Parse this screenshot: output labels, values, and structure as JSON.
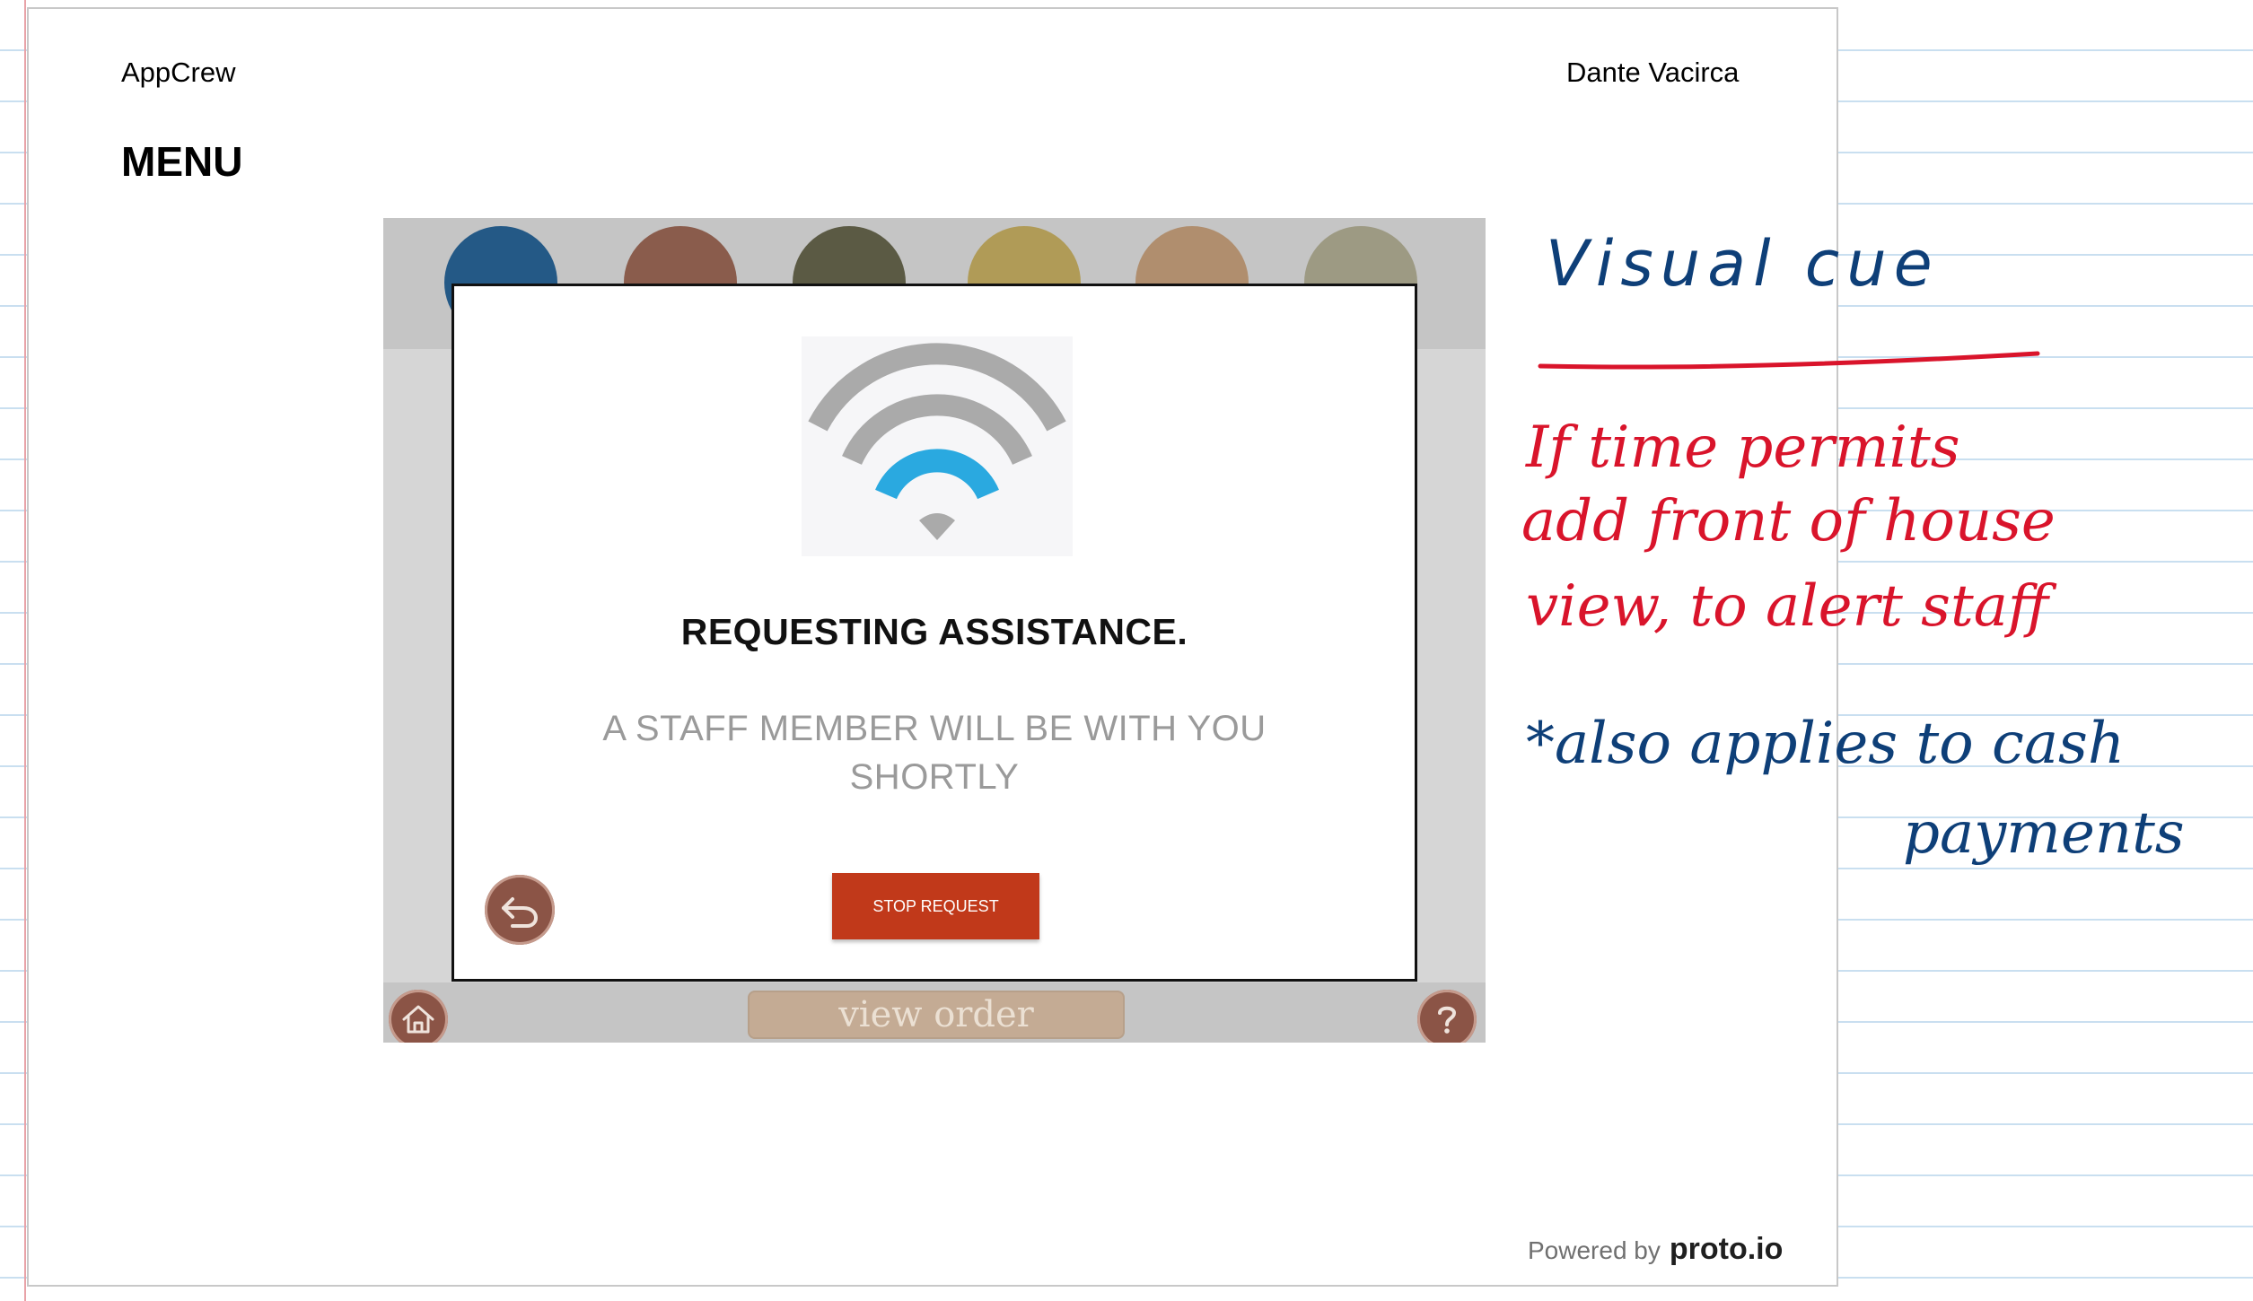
{
  "header": {
    "app_name": "AppCrew",
    "author": "Dante Vacirca",
    "page_title": "MENU"
  },
  "screen": {
    "category_circle_colors": [
      "#245986",
      "#8a5c4c",
      "#5b5a44",
      "#b09b57",
      "#b08e6e",
      "#9d9a83"
    ],
    "modal": {
      "heading": "REQUESTING ASSISTANCE.",
      "message": "A STAFF MEMBER WILL BE WITH YOU SHORTLY",
      "stop_button_label": "STOP REQUEST"
    },
    "bottom_bar": {
      "view_order_label": "view order"
    },
    "icons": [
      "wifi-icon",
      "back-arrow-icon",
      "home-icon",
      "help-icon"
    ]
  },
  "handwritten_notes": {
    "title": "Visual cue",
    "note_1": [
      "If time permits",
      "add front of house",
      "view, to alert staff"
    ],
    "note_2": [
      "*also applies to cash",
      "payments"
    ]
  },
  "footer": {
    "powered_by": "Powered by",
    "brand": "proto.io"
  },
  "colors": {
    "accent_red": "#c1391a",
    "brown": "#8b5446",
    "wifi_blue": "#2aa9e0",
    "ink_red": "#d9142b",
    "ink_blue": "#0e3f78"
  }
}
